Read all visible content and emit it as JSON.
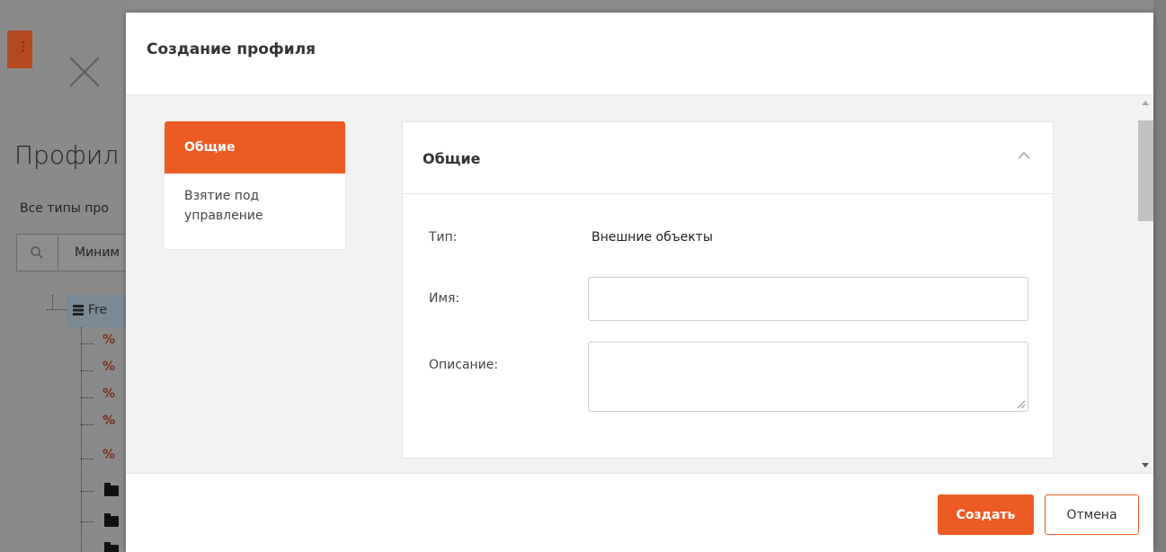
{
  "background": {
    "page_title": "Профил",
    "filter_label": "Все типы про",
    "search_text": "Миним",
    "tree_root_label": "Fre"
  },
  "modal": {
    "title": "Создание профиля",
    "nav": {
      "items": [
        {
          "label": "Общие",
          "active": true
        },
        {
          "label": "Взятие под управление",
          "active": false
        }
      ]
    },
    "section": {
      "title": "Общие",
      "type_label": "Тип:",
      "type_value": "Внешние объекты",
      "name_label": "Имя:",
      "name_value": "",
      "description_label": "Описание:",
      "description_value": ""
    },
    "footer": {
      "create_label": "Создать",
      "cancel_label": "Отмена"
    }
  },
  "colors": {
    "accent": "#ed5b24",
    "overlay": "#8a8a8a"
  }
}
